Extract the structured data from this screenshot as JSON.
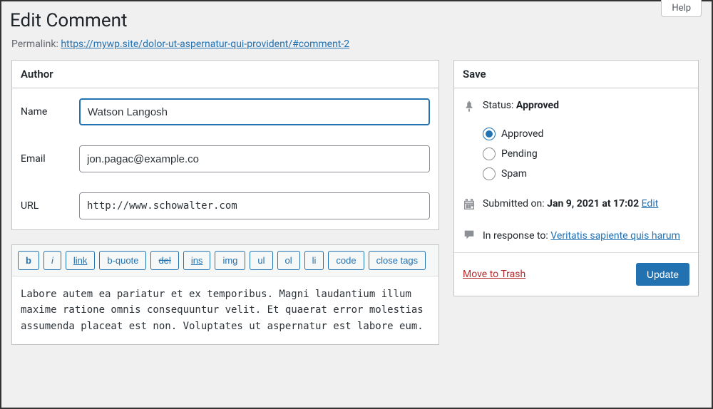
{
  "help_label": "Help",
  "page_title": "Edit Comment",
  "permalink": {
    "label": "Permalink:",
    "url": "https://mywp.site/dolor-ut-aspernatur-qui-provident/#comment-2"
  },
  "author": {
    "heading": "Author",
    "name_label": "Name",
    "name_value": "Watson Langosh",
    "email_label": "Email",
    "email_value": "jon.pagac@example.co",
    "url_label": "URL",
    "url_value": "http://www.schowalter.com"
  },
  "editor": {
    "buttons": {
      "b": "b",
      "i": "i",
      "link": "link",
      "bquote": "b-quote",
      "del": "del",
      "ins": "ins",
      "img": "img",
      "ul": "ul",
      "ol": "ol",
      "li": "li",
      "code": "code",
      "close": "close tags"
    },
    "content": "Labore autem ea pariatur et ex temporibus. Magni laudantium illum maxime ratione omnis consequuntur velit. Et quaerat error molestias assumenda placeat est non. Voluptates ut aspernatur est labore eum."
  },
  "save": {
    "heading": "Save",
    "status_label": "Status:",
    "status_value": "Approved",
    "radios": {
      "approved": "Approved",
      "pending": "Pending",
      "spam": "Spam"
    },
    "submitted_label": "Submitted on:",
    "submitted_value": "Jan 9, 2021 at 17:02",
    "edit_label": "Edit",
    "response_label": "In response to:",
    "response_link": "Veritatis sapiente quis harum",
    "trash_label": "Move to Trash",
    "update_label": "Update"
  }
}
